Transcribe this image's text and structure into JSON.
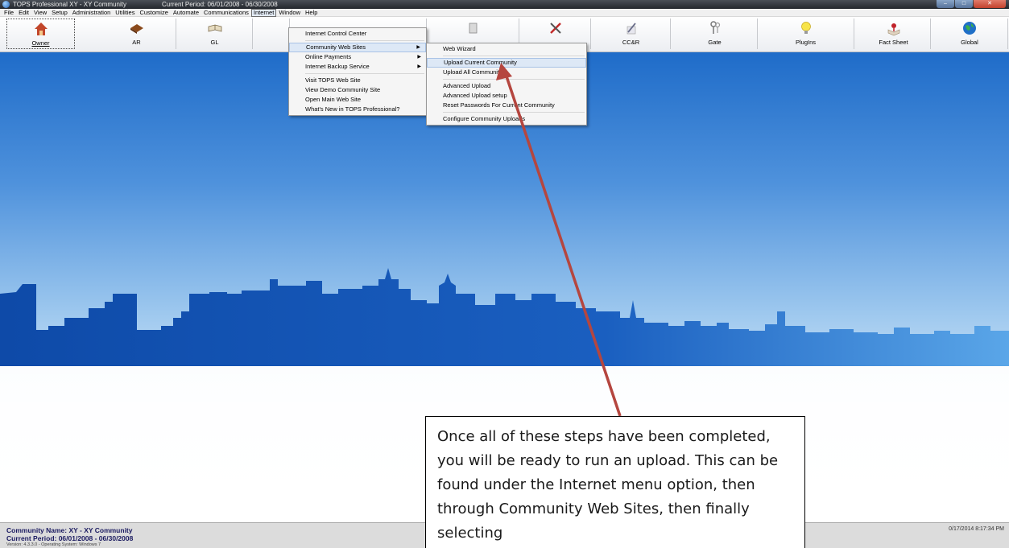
{
  "window": {
    "title": "TOPS Professional  XY - XY Community",
    "period": "Current Period: 06/01/2008 - 06/30/2008"
  },
  "menubar": [
    "File",
    "Edit",
    "View",
    "Setup",
    "Administration",
    "Utilities",
    "Customize",
    "Automate",
    "Communications",
    "Internet",
    "Window",
    "Help"
  ],
  "toolbar": [
    {
      "label": "Owner",
      "icon": "house-icon"
    },
    {
      "label": "AR",
      "icon": "book-icon"
    },
    {
      "label": "GL",
      "icon": "open-book-icon"
    },
    {
      "label": "",
      "icon": "blank"
    },
    {
      "label": "",
      "icon": "hidden"
    },
    {
      "label": "",
      "icon": "document-icon"
    },
    {
      "label": "",
      "icon": "tools-icon"
    },
    {
      "label": "CC&R",
      "icon": "pen-icon"
    },
    {
      "label": "Gate",
      "icon": "keys-icon"
    },
    {
      "label": "PlugIns",
      "icon": "lightbulb-icon"
    },
    {
      "label": "Fact Sheet",
      "icon": "fact-sheet-icon"
    },
    {
      "label": "Global",
      "icon": "globe-icon"
    }
  ],
  "internet_menu": {
    "items": [
      {
        "label": "Internet Control Center",
        "submenu": false
      },
      {
        "sep": true
      },
      {
        "label": "Community Web Sites",
        "submenu": true,
        "hover": true
      },
      {
        "label": "Online Payments",
        "submenu": true
      },
      {
        "label": "Internet Backup Service",
        "submenu": true
      },
      {
        "sep": true
      },
      {
        "label": "Visit TOPS Web Site",
        "submenu": false
      },
      {
        "label": "View Demo Community Site",
        "submenu": false
      },
      {
        "label": "Open Main Web Site",
        "submenu": false
      },
      {
        "label": "What's New in TOPS Professional?",
        "submenu": false
      }
    ]
  },
  "community_submenu": {
    "items": [
      {
        "label": "Web Wizard"
      },
      {
        "sep": true
      },
      {
        "label": "Upload Current Community",
        "hover": true
      },
      {
        "label": "Upload All Communities"
      },
      {
        "sep": true
      },
      {
        "label": "Advanced Upload"
      },
      {
        "label": "Advanced Upload setup"
      },
      {
        "label": "Reset Passwords For Current Community"
      },
      {
        "sep": true
      },
      {
        "label": "Configure Community Uploads"
      }
    ]
  },
  "statusbar": {
    "community": "Community Name: XY - XY Community",
    "period": "Current Period:     06/01/2008 - 06/30/2008",
    "version": "Version: 4.3.3.0  -  Operating System: Windows 7",
    "datetime": "0/17/2014 8:17:34 PM"
  },
  "callout": {
    "text": "Once all of these steps have been completed, you will be ready to run an upload.  This can be found under the Internet menu option, then through Community Web Sites, then finally selecting"
  },
  "colors": {
    "sky_top": "#1f6cc9",
    "skyline": "#1554b0",
    "arrow": "#b5463f"
  }
}
